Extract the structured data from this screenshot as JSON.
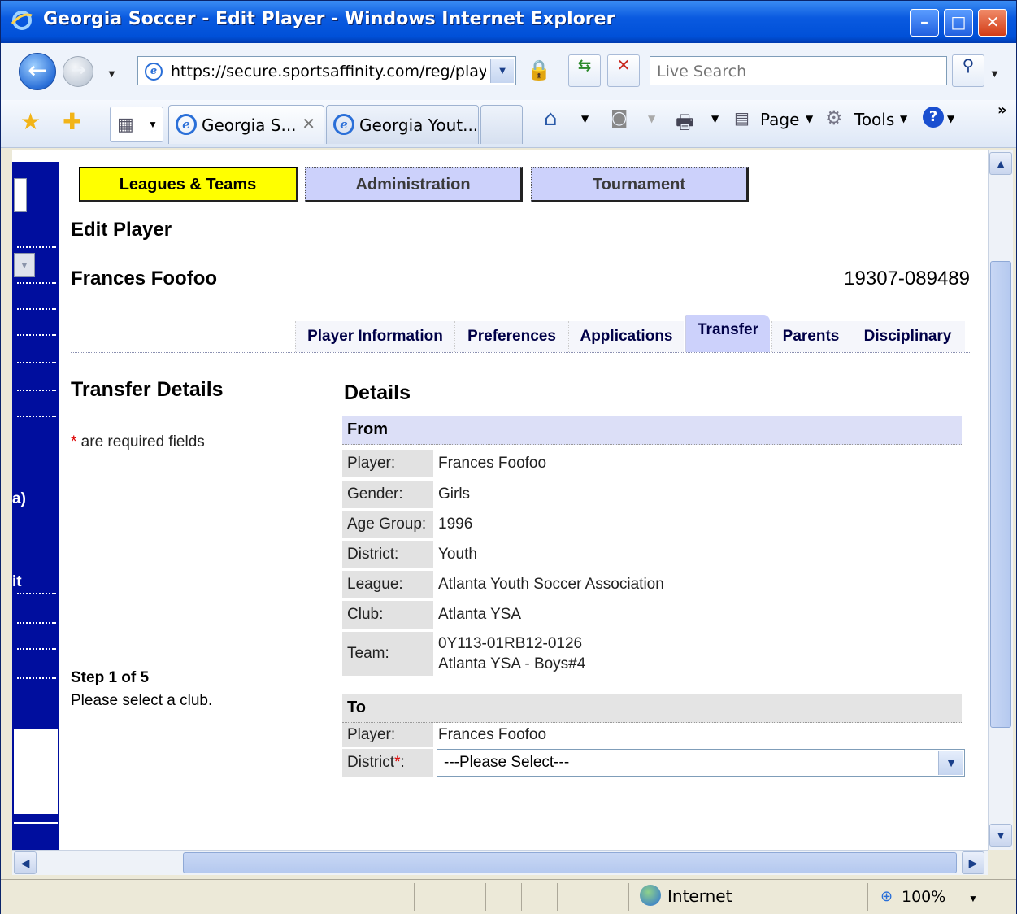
{
  "window": {
    "title": "Georgia Soccer - Edit Player - Windows Internet Explorer"
  },
  "address": {
    "url": "https://secure.sportsaffinity.com/reg/playe"
  },
  "search": {
    "placeholder": "Live Search"
  },
  "browser_tabs": [
    {
      "label": "Georgia S..."
    },
    {
      "label": "Georgia Yout..."
    }
  ],
  "commandbar": {
    "page": "Page",
    "tools": "Tools"
  },
  "topnav": [
    {
      "label": "Leagues & Teams"
    },
    {
      "label": "Administration"
    },
    {
      "label": "Tournament"
    }
  ],
  "leftnav_fragments": {
    "a": "a)",
    "b": "it"
  },
  "page": {
    "heading": "Edit Player",
    "player_name": "Frances Foofoo",
    "player_id": "19307-089489"
  },
  "player_tabs": [
    {
      "label": "Player Information"
    },
    {
      "label": "Preferences"
    },
    {
      "label": "Applications"
    },
    {
      "label": "Transfer"
    },
    {
      "label": "Parents"
    },
    {
      "label": "Disciplinary"
    }
  ],
  "transfer": {
    "heading": "Transfer Details",
    "required_star": "*",
    "required_note": " are required fields",
    "step_title": "Step 1 of 5",
    "step_text": "Please select a club."
  },
  "details": {
    "heading": "Details",
    "from": {
      "title": "From",
      "player_label": "Player:",
      "player": "Frances Foofoo",
      "gender_label": "Gender:",
      "gender": "Girls",
      "age_label": "Age Group:",
      "age": "1996",
      "district_label": "District:",
      "district": "Youth",
      "league_label": "League:",
      "league": "Atlanta Youth Soccer Association",
      "club_label": "Club:",
      "club": "Atlanta YSA",
      "team_label": "Team:",
      "team_code": "0Y113-01RB12-0126",
      "team_name": "Atlanta YSA - Boys#4"
    },
    "to": {
      "title": "To",
      "player_label": "Player:",
      "player": "Frances Foofoo",
      "district_label": "District",
      "district_star": "*",
      "district_colon": ":",
      "district_select": "---Please Select---"
    }
  },
  "status": {
    "zone": "Internet",
    "zoom": "100%"
  }
}
